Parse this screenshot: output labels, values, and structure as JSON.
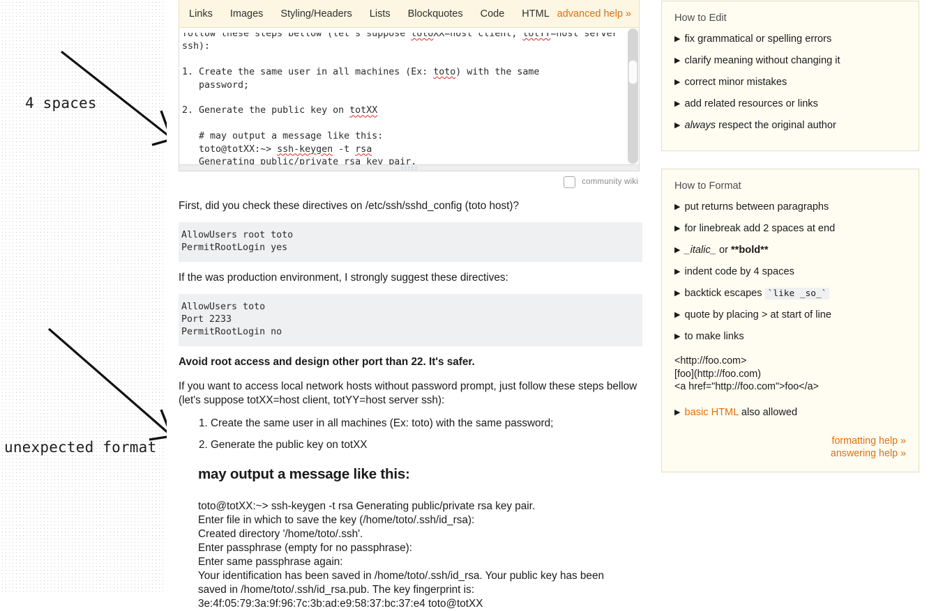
{
  "annotations": [
    {
      "name": "4-spaces",
      "text": "4 spaces"
    },
    {
      "name": "unexpected-format",
      "text": "unexpected format"
    }
  ],
  "editor": {
    "toolbar": {
      "items": [
        "Links",
        "Images",
        "Styling/Headers",
        "Lists",
        "Blockquotes",
        "Code",
        "HTML"
      ],
      "advanced_help": "advanced help »"
    },
    "clipped_top_line": "follow these steps bellow (let's suppose totXX=host client, totYY=host server",
    "textarea_value_lines": [
      "ssh):",
      "",
      "1. Create the same user in all machines (Ex: toto) with the same",
      "   password;",
      "",
      "2. Generate the public key on totXX",
      "",
      "   # may output a message like this:",
      "   toto@totXX:~> ssh-keygen -t rsa",
      "   Generating public/private rsa key pair."
    ],
    "misspelled_words": [
      "toto",
      "totXX",
      "ssh-keygen",
      "rsa"
    ],
    "scroll_thumb_position": "near-top",
    "resize_grip": "resize-grip"
  },
  "wiki": {
    "label": "community wiki",
    "checked": false
  },
  "post": {
    "para_1": "First, did you check these directives on /etc/ssh/sshd_config (toto host)?",
    "code_1": "AllowUsers root toto\nPermitRootLogin yes",
    "para_2": "If the was production environment, I strongly suggest these directives:",
    "code_2": "AllowUsers toto\nPort 2233\nPermitRootLogin no",
    "bold_note": "Avoid root access and design other port than 22. It's safer.",
    "para_3": "If you want to access local network hosts without password prompt, just follow these steps bellow (let's suppose totXX=host client, totYY=host server ssh):",
    "steps": [
      "Create the same user in all machines (Ex: toto) with the same password;",
      "Generate the public key on totXX"
    ],
    "heading": "may output a message like this:",
    "console_lines": [
      "toto@totXX:~> ssh-keygen -t rsa Generating public/private rsa key pair.",
      "Enter file in which to save the key (/home/toto/.ssh/id_rsa):",
      "Created directory '/home/toto/.ssh'.",
      "Enter passphrase (empty for no passphrase):",
      "Enter same passphrase again:",
      "Your identification has been saved in /home/toto/.ssh/id_rsa. Your public key has been",
      "saved in /home/toto/.ssh/id_rsa.pub. The key fingerprint is:",
      "3e:4f:05:79:3a:9f:96:7c:3b:ad:e9:58:37:bc:37:e4 toto@totXX"
    ]
  },
  "sidebar": {
    "how_to_edit": {
      "title": "How to Edit",
      "items": [
        {
          "text": "fix grammatical or spelling errors"
        },
        {
          "text": "clarify meaning without changing it"
        },
        {
          "text": "correct minor mistakes"
        },
        {
          "text": "add related resources or links"
        },
        {
          "text": "always respect the original author",
          "italic_prefix": "always",
          "rest": " respect the original author"
        }
      ]
    },
    "how_to_format": {
      "title": "How to Format",
      "items": [
        {
          "text": "put returns between paragraphs"
        },
        {
          "text": "for linebreak add 2 spaces at end"
        },
        {
          "text": "_italic_ or **bold**"
        },
        {
          "text": "indent code by 4 spaces"
        },
        {
          "text": "backtick escapes `like _so_`"
        },
        {
          "text": "quote by placing > at start of line"
        },
        {
          "text": "to make links"
        }
      ],
      "italic_token": "_italic_",
      "or_token": " or ",
      "bold_token": "**bold**",
      "backtick_prefix": "backtick escapes ",
      "backtick_code": "`like _so_`",
      "link_examples": [
        "<http://foo.com>",
        "[foo](http://foo.com)",
        "<a href=\"http://foo.com\">foo</a>"
      ],
      "basic_html_link": "basic HTML",
      "basic_html_rest": " also allowed",
      "help_links": [
        "formatting help »",
        "answering help »"
      ]
    }
  },
  "colors": {
    "accent_orange": "#e1700a",
    "toolbar_bg": "#fdf6e2",
    "panel_bg": "#fffdf2",
    "panel_border": "#e6dcbe",
    "code_bg": "#eff0f1",
    "squiggle_red": "#e02222"
  }
}
